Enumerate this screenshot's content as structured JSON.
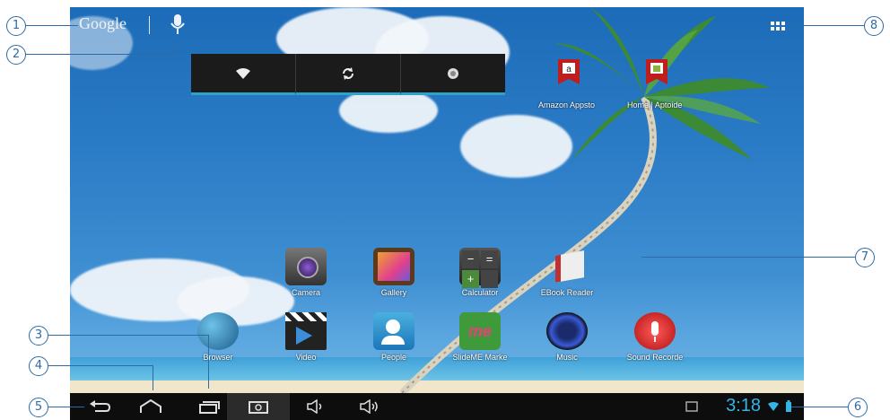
{
  "search": {
    "label": "Google"
  },
  "quick_settings": [
    {
      "icon": "wifi-icon",
      "glyph": "▼"
    },
    {
      "icon": "sync-icon",
      "glyph": "↻"
    },
    {
      "icon": "gps-icon",
      "glyph": "◉"
    }
  ],
  "shortcuts": {
    "amazon": "Amazon Appsto",
    "home": "Home | Aptoide"
  },
  "apps": {
    "camera": "Camera",
    "gallery": "Gallery",
    "calculator": "Calculator",
    "ebook": "EBook Reader",
    "browser": "Browser",
    "video": "Video",
    "people": "People",
    "slideme": "SlideME Marke",
    "music": "Music",
    "sound": "Sound Recorde"
  },
  "status": {
    "time": "3:18"
  },
  "callouts": [
    "1",
    "2",
    "3",
    "4",
    "5",
    "6",
    "7",
    "8"
  ],
  "colors": {
    "accent": "#35b5e5",
    "callout": "#2d6aa8"
  }
}
